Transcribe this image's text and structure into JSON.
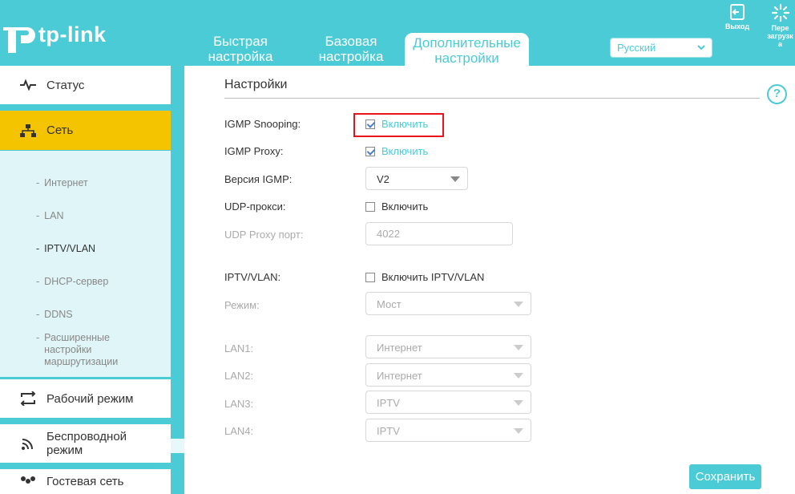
{
  "brand": {
    "logo_text": "tp-link",
    "accent": "#4acbd6",
    "active_yellow": "#f5c400"
  },
  "nav": {
    "tab1": [
      "Быстрая",
      "настройка"
    ],
    "tab2": [
      "Базовая",
      "настройка"
    ],
    "tab3": [
      "Дополнительные",
      "настройки"
    ]
  },
  "language": {
    "selected": "Русский"
  },
  "header_buttons": {
    "logout": "Выход",
    "reboot_lines": [
      "Пере",
      "загрузк",
      "а"
    ]
  },
  "sidebar": {
    "status": "Статус",
    "network": "Сеть",
    "submenu": [
      "Интернет",
      "LAN",
      "IPTV/VLAN",
      "DHCP-сервер",
      "DDNS",
      [
        "Расширенные",
        "настройки",
        "маршрутизации"
      ]
    ],
    "operation_mode": "Рабочий режим",
    "wireless": [
      "Беспроводной",
      "режим"
    ],
    "guest": "Гостевая сеть"
  },
  "main": {
    "title": "Настройки",
    "igmp_snooping": {
      "label": "IGMP Snooping:",
      "checkbox": "Включить",
      "checked": true
    },
    "igmp_proxy": {
      "label": "IGMP Proxy:",
      "checkbox": "Включить",
      "checked": true
    },
    "igmp_version": {
      "label": "Версия IGMP:",
      "value": "V2"
    },
    "udp_proxy": {
      "label": "UDP-прокси:",
      "checkbox": "Включить",
      "checked": false
    },
    "udp_proxy_port": {
      "label": "UDP Proxy порт:",
      "value": "4022"
    },
    "iptv_vlan": {
      "label": "IPTV/VLAN:",
      "checkbox": "Включить IPTV/VLAN",
      "checked": false
    },
    "mode": {
      "label": "Режим:",
      "value": "Мост"
    },
    "lan1": {
      "label": "LAN1:",
      "value": "Интернет"
    },
    "lan2": {
      "label": "LAN2:",
      "value": "Интернет"
    },
    "lan3": {
      "label": "LAN3:",
      "value": "IPTV"
    },
    "lan4": {
      "label": "LAN4:",
      "value": "IPTV"
    },
    "save": "Сохранить"
  }
}
